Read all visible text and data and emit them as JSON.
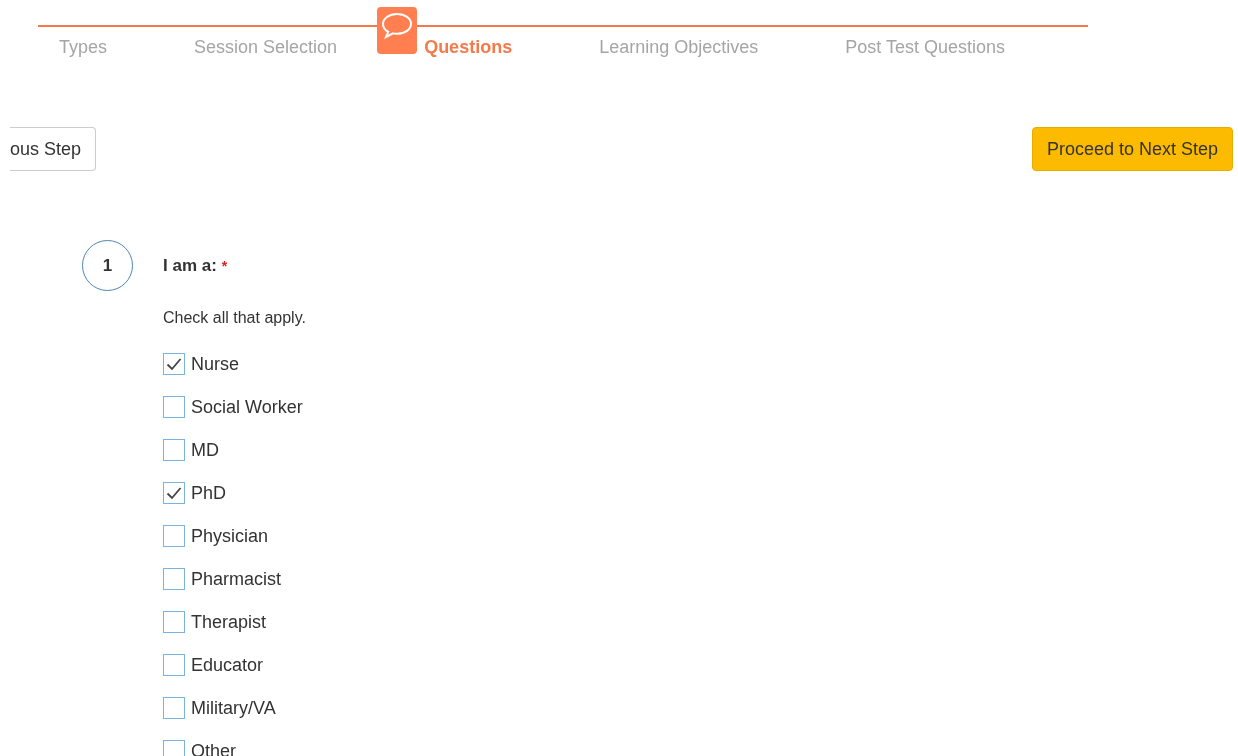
{
  "steps": [
    {
      "label": "Types",
      "selected": false
    },
    {
      "label": "Session Selection",
      "selected": false
    },
    {
      "label": "Questions",
      "selected": true
    },
    {
      "label": "Learning Objectives",
      "selected": false
    },
    {
      "label": "Post Test Questions",
      "selected": false
    }
  ],
  "previous_button": "ous Step",
  "next_button": "Proceed to Next Step",
  "question": {
    "number": "1",
    "title": "I am a:",
    "required_mark": "*",
    "hint": "Check all that apply.",
    "options": [
      {
        "label": "Nurse",
        "checked": true
      },
      {
        "label": "Social Worker",
        "checked": false
      },
      {
        "label": "MD",
        "checked": false
      },
      {
        "label": "PhD",
        "checked": true
      },
      {
        "label": "Physician",
        "checked": false
      },
      {
        "label": "Pharmacist",
        "checked": false
      },
      {
        "label": "Therapist",
        "checked": false
      },
      {
        "label": "Educator",
        "checked": false
      },
      {
        "label": "Military/VA",
        "checked": false
      },
      {
        "label": "Other",
        "checked": false
      }
    ]
  }
}
